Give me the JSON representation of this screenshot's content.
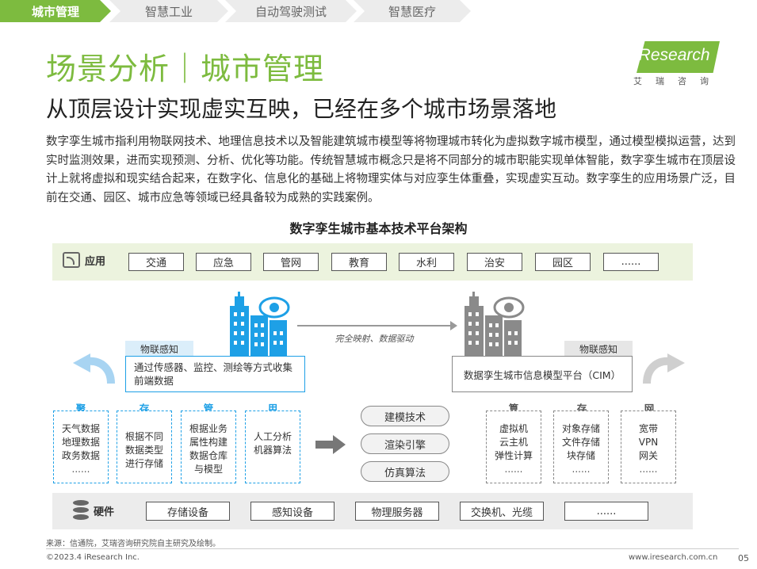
{
  "tabs": [
    {
      "label": "城市管理",
      "active": true
    },
    {
      "label": "智慧工业",
      "active": false
    },
    {
      "label": "自动驾驶测试",
      "active": false
    },
    {
      "label": "智慧医疗",
      "active": false
    }
  ],
  "title": "场景分析｜城市管理",
  "subtitle": "从顶层设计实现虚实互映，已经在多个城市场景落地",
  "paragraph": "数字孪生城市指利用物联网技术、地理信息技术以及智能建筑城市模型等将物理城市转化为虚拟数字城市模型，通过模型模拟运营，达到实时监测效果，进而实现预测、分析、优化等功能。传统智慧城市概念只是将不同部分的城市职能实现单体智能，数字孪生城市在顶层设计上就将虚拟和现实结合起来，在数字化、信息化的基础上将物理实体与对应孪生体重叠，实现虚实互动。数字孪生的应用场景广泛，目前在交通、园区、城市应急等领域已经具备较为成熟的实践案例。",
  "logo": {
    "brand": "iResearch",
    "sub": "艾瑞咨询"
  },
  "diagram": {
    "title": "数字孪生城市基本技术平台架构",
    "app_label": "应用",
    "apps": [
      "交通",
      "应急",
      "管网",
      "教育",
      "水利",
      "治安",
      "园区",
      "......"
    ],
    "left_tag": "物联感知",
    "left_box": "通过传感器、监控、测绘等方式收集前端数据",
    "right_tag": "物联感知",
    "right_box": "数据孪生城市信息模型平台（CIM）",
    "mapping_label": "完全映射、数据驱动",
    "left_cols": [
      {
        "head": "聚",
        "lines": [
          "天气数据",
          "地理数据",
          "政务数据",
          "......"
        ]
      },
      {
        "head": "存",
        "lines": [
          "根据不同",
          "数据类型",
          "进行存储"
        ]
      },
      {
        "head": "管",
        "lines": [
          "根据业务",
          "属性构建",
          "数据仓库",
          "与模型"
        ]
      },
      {
        "head": "用",
        "lines": [
          "人工分析",
          "机器算法"
        ]
      }
    ],
    "pills": [
      "建模技术",
      "渲染引擎",
      "仿真算法"
    ],
    "right_cols": [
      {
        "head": "算",
        "lines": [
          "虚拟机",
          "云主机",
          "弹性计算",
          "......"
        ]
      },
      {
        "head": "存",
        "lines": [
          "对象存储",
          "文件存储",
          "块存储",
          "......"
        ]
      },
      {
        "head": "网",
        "lines": [
          "宽带",
          "VPN",
          "网关",
          "......"
        ]
      }
    ],
    "hw_label": "硬件",
    "hardware": [
      "存储设备",
      "感知设备",
      "物理服务器",
      "交换机、光缆",
      "......"
    ]
  },
  "source": "来源：信通院，艾瑞咨询研究院自主研究及绘制。",
  "copyright": "©2023.4 iResearch Inc.",
  "site": "www.iresearch.com.cn",
  "page": "05",
  "colors": {
    "green": "#7dbb3f",
    "blue": "#1ea0e6",
    "gray": "#888888"
  }
}
